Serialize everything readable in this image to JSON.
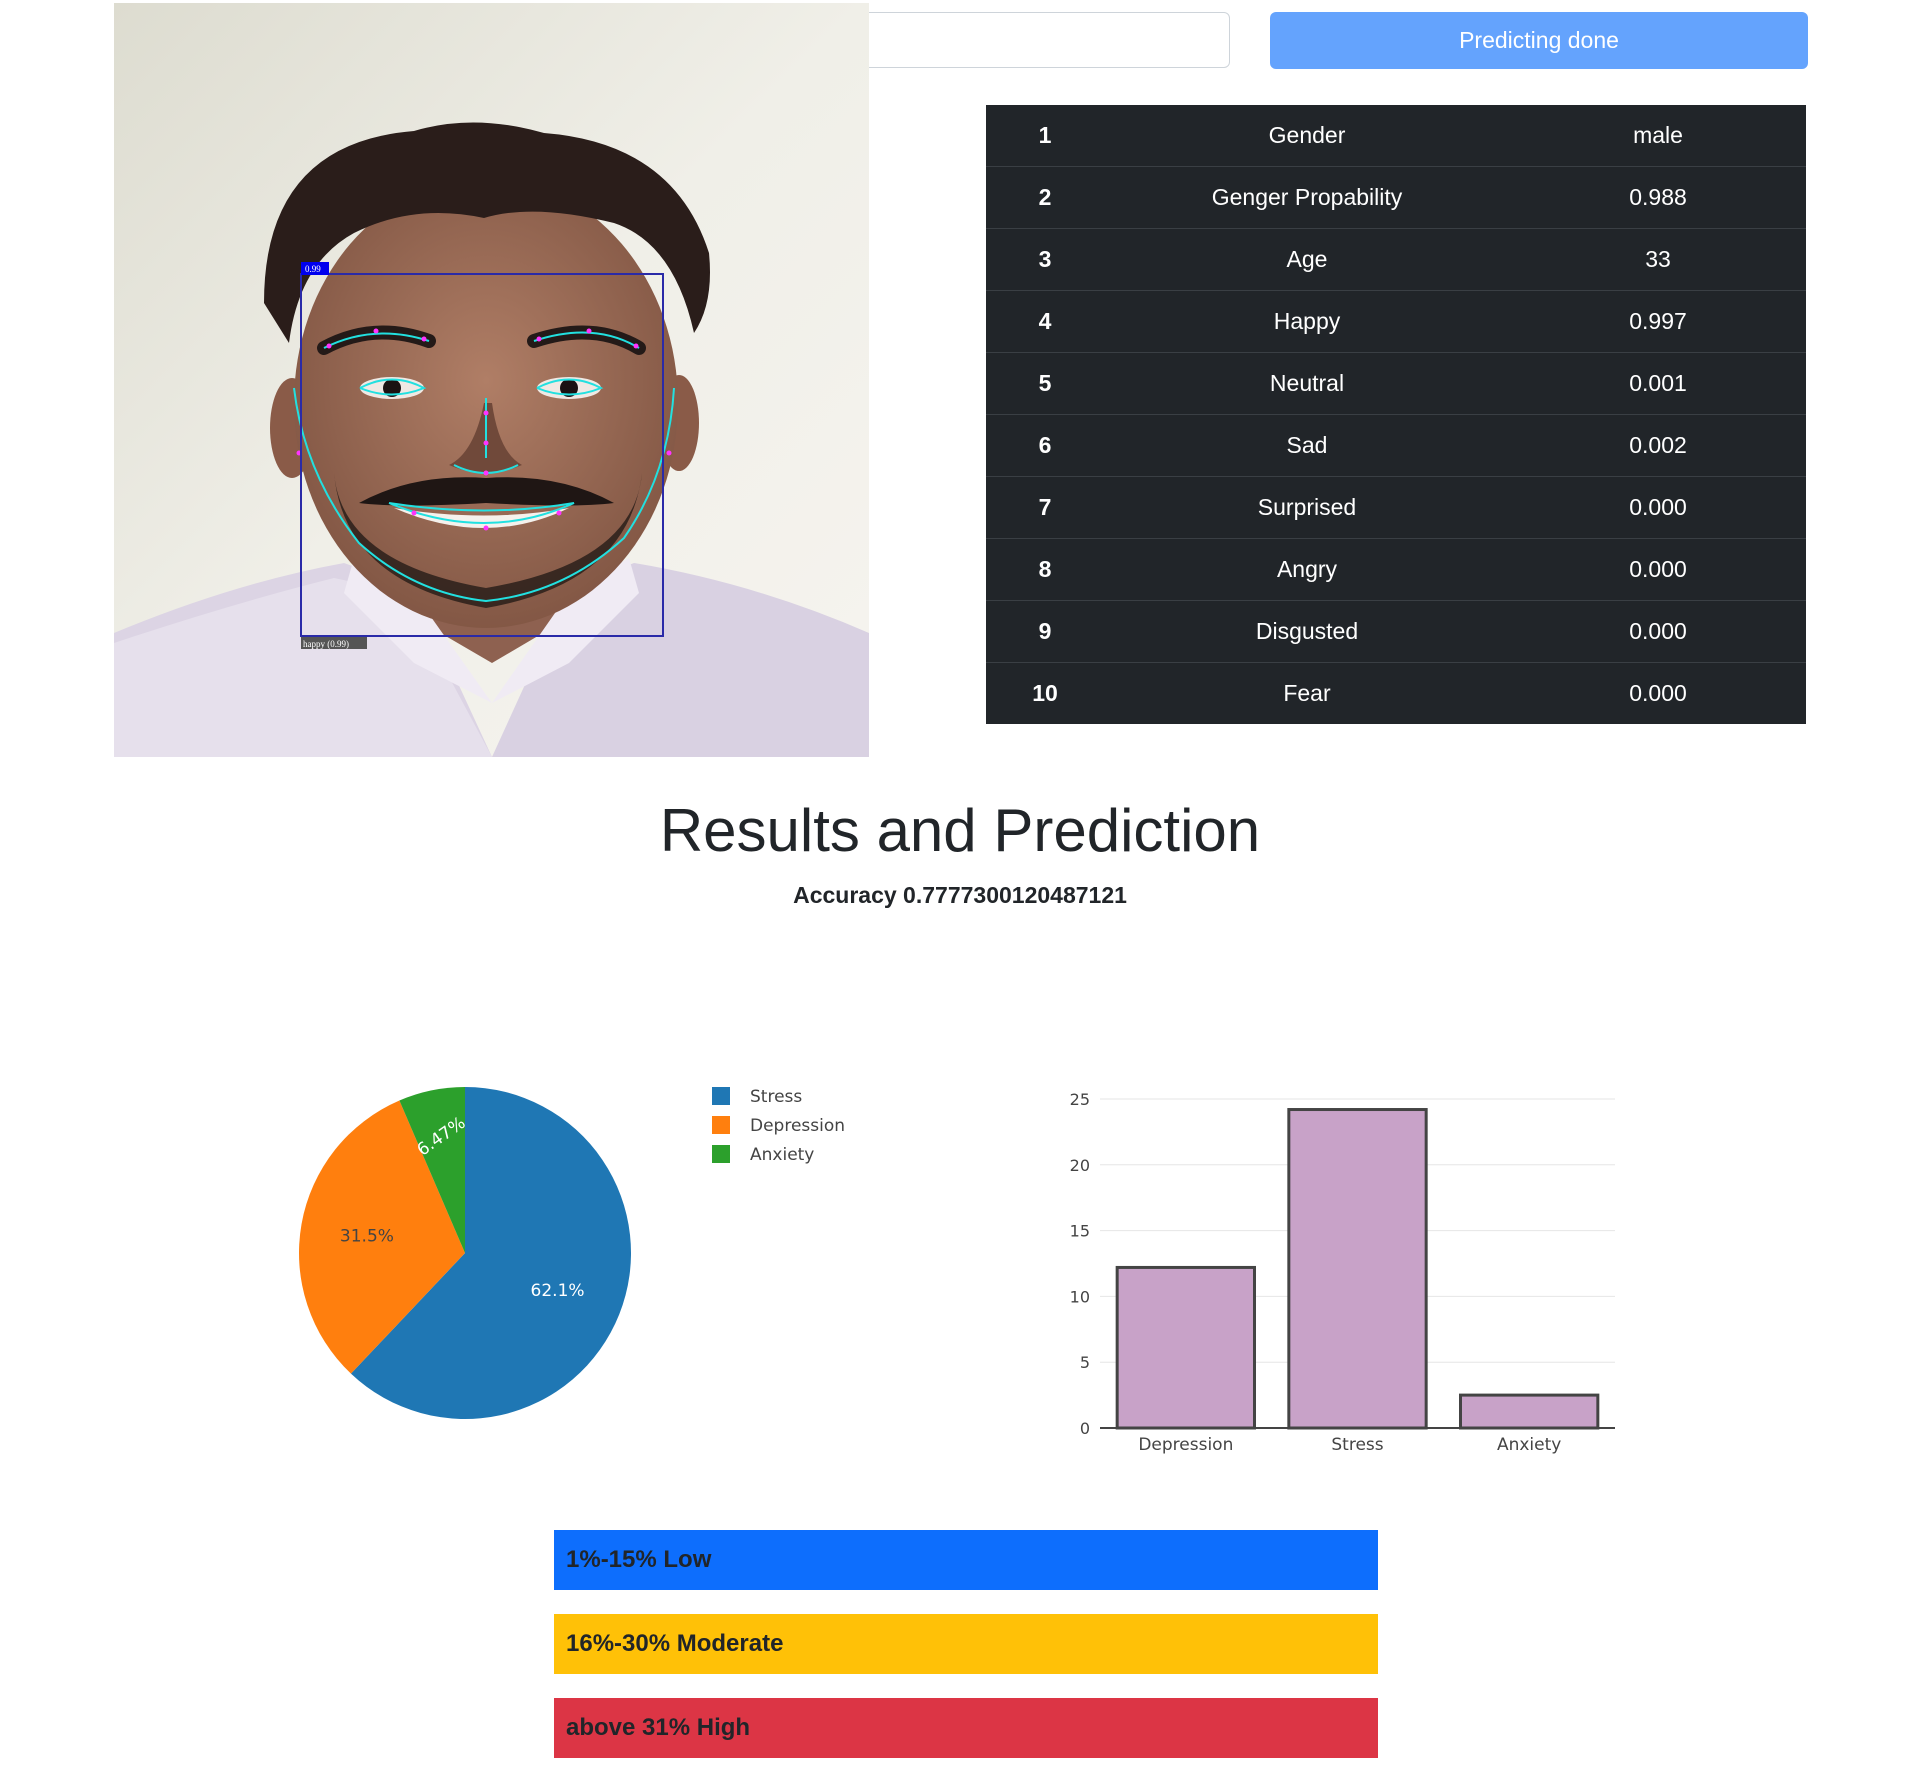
{
  "header": {
    "predict_button_label": "Predicting done"
  },
  "image": {
    "box_score": "0.99",
    "emotion_label": "happy (0.99)"
  },
  "results_table": [
    {
      "index": "1",
      "label": "Gender",
      "value": "male"
    },
    {
      "index": "2",
      "label": "Genger Propability",
      "value": "0.988"
    },
    {
      "index": "3",
      "label": "Age",
      "value": "33"
    },
    {
      "index": "4",
      "label": "Happy",
      "value": "0.997"
    },
    {
      "index": "5",
      "label": "Neutral",
      "value": "0.001"
    },
    {
      "index": "6",
      "label": "Sad",
      "value": "0.002"
    },
    {
      "index": "7",
      "label": "Surprised",
      "value": "0.000"
    },
    {
      "index": "8",
      "label": "Angry",
      "value": "0.000"
    },
    {
      "index": "9",
      "label": "Disgusted",
      "value": "0.000"
    },
    {
      "index": "10",
      "label": "Fear",
      "value": "0.000"
    }
  ],
  "results": {
    "title": "Results and Prediction",
    "accuracy_text": "Accuracy 0.7777300120487121"
  },
  "chart_data": [
    {
      "type": "pie",
      "title": "",
      "categories": [
        "Stress",
        "Depression",
        "Anxiety"
      ],
      "values": [
        62.1,
        31.5,
        6.47
      ],
      "labels": [
        "62.1%",
        "31.5%",
        "6.47%"
      ],
      "colors": [
        "#1f77b4",
        "#ff7f0e",
        "#2ca02c"
      ],
      "legend": "top-right"
    },
    {
      "type": "bar",
      "title": "",
      "categories": [
        "Depression",
        "Stress",
        "Anxiety"
      ],
      "values": [
        12.2,
        24.2,
        2.5
      ],
      "ylim": [
        0,
        25
      ],
      "yticks": [
        "0",
        "5",
        "10",
        "15",
        "20",
        "25"
      ],
      "bar_color": "#c8a2c8",
      "grid": true
    }
  ],
  "severity_levels": [
    {
      "label": "1%-15% Low",
      "color": "#0d6efd"
    },
    {
      "label": "16%-30% Moderate",
      "color": "#ffc107"
    },
    {
      "label": "above 31% High",
      "color": "#dc3545"
    }
  ]
}
